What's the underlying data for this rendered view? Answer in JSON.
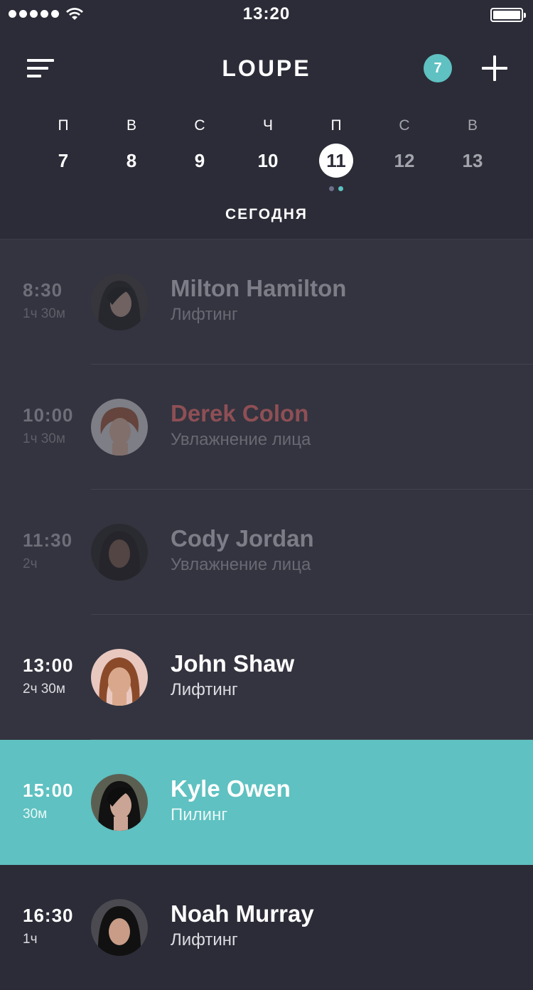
{
  "status": {
    "time": "13:20"
  },
  "header": {
    "title": "LOUPE",
    "badge": "7"
  },
  "week": {
    "days": [
      {
        "weekday": "П",
        "date": "7"
      },
      {
        "weekday": "В",
        "date": "8"
      },
      {
        "weekday": "С",
        "date": "9"
      },
      {
        "weekday": "Ч",
        "date": "10"
      },
      {
        "weekday": "П",
        "date": "11"
      },
      {
        "weekday": "С",
        "date": "12"
      },
      {
        "weekday": "В",
        "date": "13"
      }
    ],
    "selected_index": 4,
    "today_label": "СЕГОДНЯ"
  },
  "colors": {
    "accent": "#5fc1c1",
    "background": "#2b2c37",
    "list_bg": "#33343f",
    "alert": "#8e4f55",
    "dot_muted": "#6d6e8a"
  },
  "appointments": [
    {
      "time": "8:30",
      "duration": "1ч 30м",
      "name": "Milton Hamilton",
      "service": "Лифтинг"
    },
    {
      "time": "10:00",
      "duration": "1ч 30м",
      "name": "Derek Colon",
      "service": "Увлажнение лица"
    },
    {
      "time": "11:30",
      "duration": "2ч",
      "name": "Cody Jordan",
      "service": "Увлажнение лица"
    },
    {
      "time": "13:00",
      "duration": "2ч 30м",
      "name": "John Shaw",
      "service": "Лифтинг"
    },
    {
      "time": "15:00",
      "duration": "30м",
      "name": "Kyle Owen",
      "service": "Пилинг"
    },
    {
      "time": "16:30",
      "duration": "1ч",
      "name": "Noah Murray",
      "service": "Лифтинг"
    }
  ]
}
